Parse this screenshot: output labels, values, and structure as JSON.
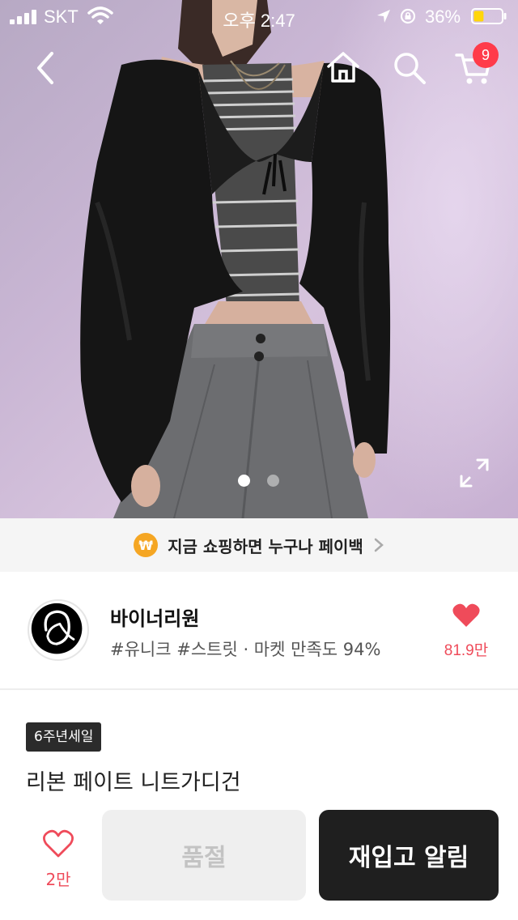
{
  "status_bar": {
    "carrier": "SKT",
    "time": "오후 2:47",
    "battery_percent": "36%",
    "battery_level": 0.36,
    "icons": [
      "signal-icon",
      "wifi-icon",
      "location-icon",
      "rotation-lock-icon",
      "battery-icon"
    ]
  },
  "nav": {
    "icons": [
      "back-icon",
      "home-icon",
      "search-icon",
      "cart-icon"
    ],
    "cart_count": "9"
  },
  "gallery": {
    "image_count": 2,
    "active_index": 0,
    "icons": [
      "expand-icon"
    ]
  },
  "banner": {
    "coin_symbol": "₩",
    "text": "지금 쇼핑하면 누구나 페이백",
    "icon": "chevron-right-icon"
  },
  "shop": {
    "name": "바이너리원",
    "tags": "#유니크 #스트릿 · 마켓 만족도 94%",
    "likes": "81.9만",
    "like_color": "#ef4b5a"
  },
  "product": {
    "badge": "6주년세일",
    "title": "리본 페이트 니트가디건"
  },
  "bottom_bar": {
    "like_count": "2만",
    "soldout_label": "품절",
    "restock_label": "재입고 알림",
    "accent": "#1f1f1f"
  }
}
